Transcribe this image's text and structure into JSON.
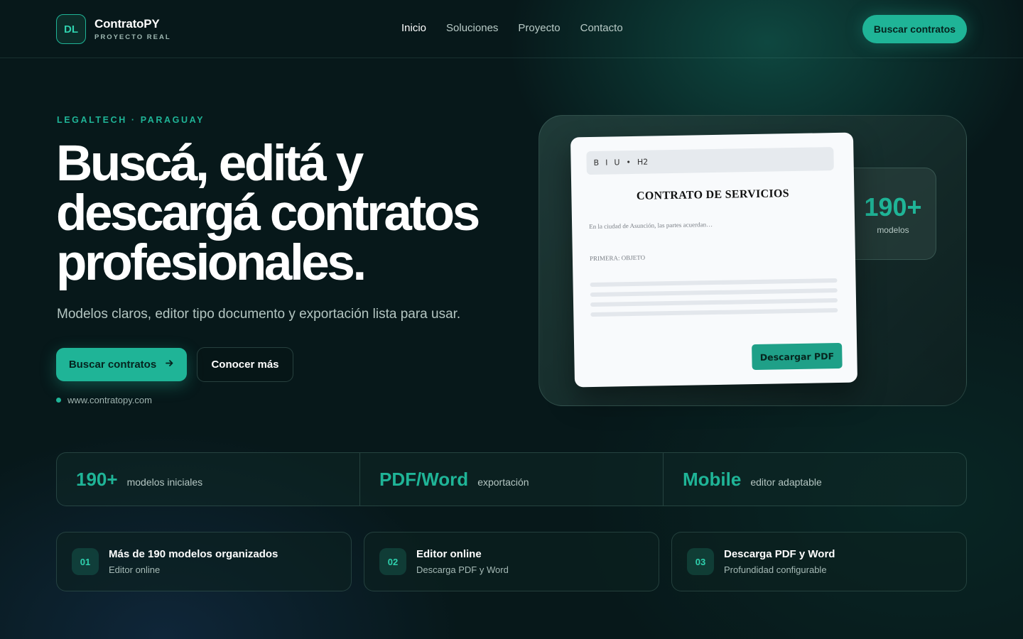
{
  "header": {
    "logo_initials": "DL",
    "brand_name": "ContratoPY",
    "brand_sub": "PROYECTO REAL",
    "nav": [
      "Inicio",
      "Soluciones",
      "Proyecto",
      "Contacto"
    ],
    "active_nav": "Inicio",
    "cta": "Buscar contratos"
  },
  "hero": {
    "eyebrow": "LEGALTECH · PARAGUAY",
    "title": "Buscá, editá y descargá contratos profesionales.",
    "subtitle": "Modelos claros, editor tipo documento y exportación lista para usar.",
    "primary_button": "Buscar contratos",
    "primary_icon": "arrow-right-icon",
    "secondary_button": "Conocer más",
    "site_url": "www.contratopy.com"
  },
  "mockup": {
    "stat_value": "190+",
    "stat_label": "modelos",
    "toolbar": [
      "B",
      "I",
      "U",
      "•",
      "H2"
    ],
    "doc_title": "CONTRATO DE SERVICIOS",
    "doc_line1": "En la ciudad de Asunción, las partes acuerdan…",
    "doc_line2": "PRIMERA: OBJETO",
    "download_button": "Descargar PDF"
  },
  "stats": [
    {
      "value": "190+",
      "label": "modelos iniciales"
    },
    {
      "value": "PDF/Word",
      "label": "exportación"
    },
    {
      "value": "Mobile",
      "label": "editor adaptable"
    }
  ],
  "features": [
    {
      "num": "01",
      "title": "Más de 190 modelos organizados",
      "sub": "Editor online"
    },
    {
      "num": "02",
      "title": "Editor online",
      "sub": "Descarga PDF y Word"
    },
    {
      "num": "03",
      "title": "Descarga PDF y Word",
      "sub": "Profundidad configurable"
    }
  ],
  "colors": {
    "accent": "#1fb497",
    "background": "#07181a"
  }
}
